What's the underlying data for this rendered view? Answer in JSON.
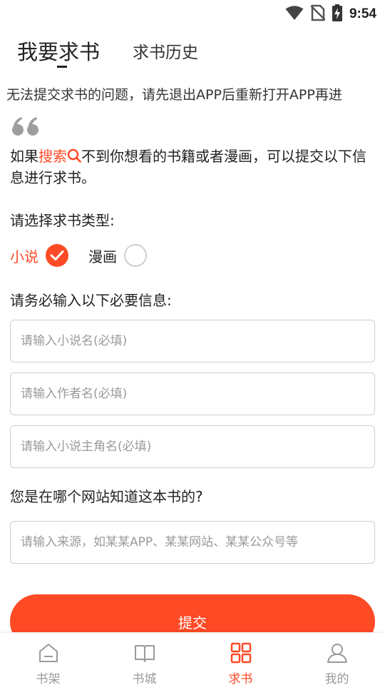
{
  "status_bar": {
    "time": "9:54",
    "icons": [
      "wifi-icon",
      "no-sim-icon",
      "battery-charging-icon"
    ]
  },
  "tabs": {
    "active_label": "我要求书",
    "inactive_label": "求书历史"
  },
  "notice": {
    "text": "无法提交求书的问题，请先退出APP后重新打开APP再进"
  },
  "intro": {
    "prefix": "如果",
    "search_word": "搜索",
    "suffix": "不到你想看的书籍或者漫画，可以提交以下信息进行求书。"
  },
  "type_section": {
    "label": "请选择求书类型:",
    "options": [
      {
        "label": "小说",
        "selected": true
      },
      {
        "label": "漫画",
        "selected": false
      }
    ]
  },
  "info_section": {
    "label": "请务必输入以下必要信息:",
    "fields": [
      {
        "placeholder": "请输入小说名(必填)",
        "value": ""
      },
      {
        "placeholder": "请输入作者名(必填)",
        "value": ""
      },
      {
        "placeholder": "请输入小说主角名(必填)",
        "value": ""
      }
    ]
  },
  "source_section": {
    "label": "您是在哪个网站知道这本书的?",
    "placeholder": "请输入来源，如某某APP、某某网站、某某公众号等",
    "value": ""
  },
  "submit_label": "提交",
  "tabbar": {
    "items": [
      {
        "label": "书架",
        "icon": "bookshelf-icon",
        "active": false
      },
      {
        "label": "书城",
        "icon": "book-icon",
        "active": false
      },
      {
        "label": "求书",
        "icon": "request-grid-icon",
        "active": true
      },
      {
        "label": "我的",
        "icon": "profile-icon",
        "active": false
      }
    ]
  },
  "colors": {
    "accent": "#ff4a26",
    "text": "#222222",
    "muted": "#9a9a9a",
    "border": "#cfcfcf"
  }
}
